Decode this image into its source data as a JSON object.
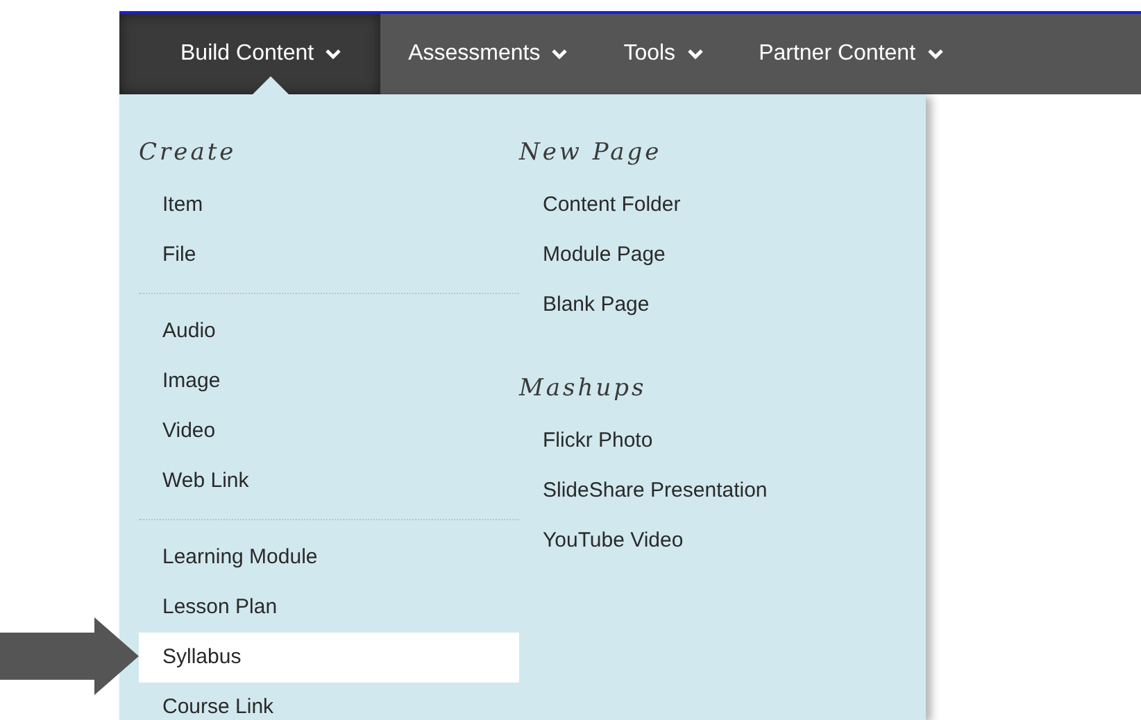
{
  "nav": {
    "tabs": [
      {
        "label": "Build Content",
        "selected": true
      },
      {
        "label": "Assessments",
        "selected": false
      },
      {
        "label": "Tools",
        "selected": false
      },
      {
        "label": "Partner Content",
        "selected": false
      }
    ]
  },
  "menu": {
    "columns": [
      {
        "sections": [
          {
            "heading": "Create",
            "items": [
              {
                "label": "Item",
                "selected": false
              },
              {
                "label": "File",
                "selected": false
              }
            ]
          },
          {
            "items": [
              {
                "label": "Audio",
                "selected": false
              },
              {
                "label": "Image",
                "selected": false
              },
              {
                "label": "Video",
                "selected": false
              },
              {
                "label": "Web Link",
                "selected": false
              }
            ]
          },
          {
            "items": [
              {
                "label": "Learning Module",
                "selected": false
              },
              {
                "label": "Lesson Plan",
                "selected": false
              },
              {
                "label": "Syllabus",
                "selected": true
              },
              {
                "label": "Course Link",
                "selected": false
              }
            ]
          }
        ]
      },
      {
        "sections": [
          {
            "heading": "New Page",
            "items": [
              {
                "label": "Content Folder",
                "selected": false
              },
              {
                "label": "Module Page",
                "selected": false
              },
              {
                "label": "Blank Page",
                "selected": false
              }
            ]
          },
          {
            "heading": "Mashups",
            "items": [
              {
                "label": "Flickr Photo",
                "selected": false
              },
              {
                "label": "SlideShare Presentation",
                "selected": false
              },
              {
                "label": "YouTube Video",
                "selected": false
              }
            ]
          }
        ]
      }
    ]
  }
}
